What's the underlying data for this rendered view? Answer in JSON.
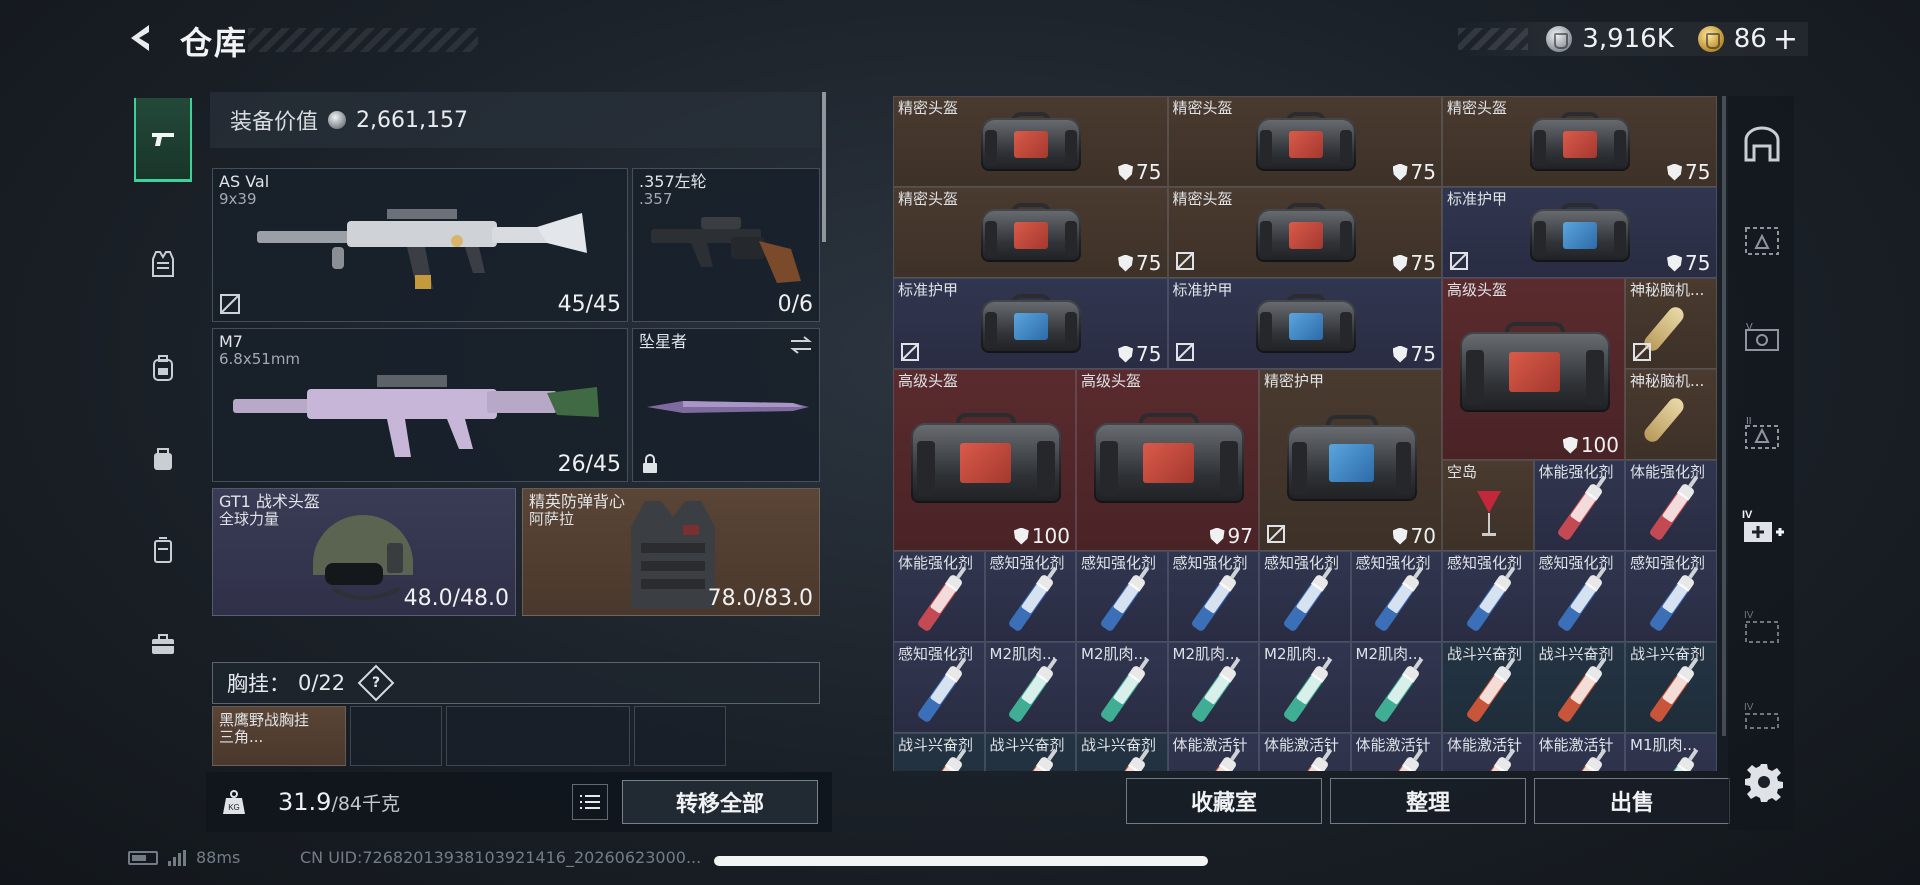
{
  "header": {
    "title": "仓库",
    "currency_silver": "3,916K",
    "currency_gold": "86",
    "currency_plus": "+"
  },
  "left": {
    "equip_value_label": "装备价值",
    "equip_value": "2,661,157",
    "weapon1": {
      "name": "AS Val",
      "sub": "9x39",
      "count": "45/45"
    },
    "weapon2": {
      "name": ".357左轮",
      "sub": ".357",
      "count": "0/6"
    },
    "weapon3": {
      "name": "M7",
      "sub": "6.8x51mm",
      "count": "26/45"
    },
    "melee": {
      "name": "坠星者"
    },
    "helmet": {
      "name": "GT1 战术头盔",
      "sub": "全球力量",
      "durability": "48.0/48.0"
    },
    "vest": {
      "name": "精英防弹背心",
      "sub": "阿萨拉",
      "durability": "78.0/83.0"
    },
    "chest_rig": {
      "label": "胸挂：",
      "count": "0/22",
      "help": "?"
    },
    "rig_item": {
      "name": "黑鹰野战胸挂",
      "sub": "三角..."
    },
    "weight_main": "31.9",
    "weight_sub": "/84千克",
    "transfer_all": "转移全部"
  },
  "grid": {
    "items": [
      {
        "label": "精密头盔",
        "value": "75",
        "color": "brown",
        "icon": "red-bag"
      },
      {
        "label": "精密头盔",
        "value": "75",
        "color": "brown",
        "icon": "red-bag"
      },
      {
        "label": "精密头盔",
        "value": "75",
        "color": "brown",
        "icon": "red-bag"
      },
      {
        "label": "精密头盔",
        "value": "75",
        "color": "brown",
        "icon": "red-bag"
      },
      {
        "label": "精密头盔",
        "value": "75",
        "color": "brown",
        "icon": "red-bag"
      },
      {
        "label": "标准护甲",
        "value": "75",
        "color": "purple",
        "icon": "blue-bag"
      },
      {
        "label": "标准护甲",
        "value": "75",
        "color": "purple",
        "icon": "blue-bag"
      },
      {
        "label": "标准护甲",
        "value": "75",
        "color": "purple",
        "icon": "blue-bag"
      },
      {
        "label": "高级头盔",
        "value": "100",
        "color": "red",
        "icon": "red-bag"
      },
      {
        "label": "神秘脑机...",
        "value": "",
        "color": "brown",
        "icon": "brain-chip"
      },
      {
        "label": "神秘脑机...",
        "value": "",
        "color": "brown",
        "icon": "brain-chip"
      },
      {
        "label": "高级头盔",
        "value": "100",
        "color": "red",
        "icon": "red-bag"
      },
      {
        "label": "高级头盔",
        "value": "97",
        "color": "red",
        "icon": "red-bag"
      },
      {
        "label": "精密护甲",
        "value": "70",
        "color": "brown",
        "icon": "blue-bag"
      },
      {
        "label": "空岛",
        "value": "",
        "color": "brown",
        "icon": "cocktail"
      },
      {
        "label": "体能强化剂",
        "value": "",
        "color": "purple",
        "icon": "syringe-red"
      },
      {
        "label": "体能强化剂",
        "value": "",
        "color": "purple",
        "icon": "syringe-red"
      }
    ],
    "row5": [
      "体能强化剂",
      "感知强化剂",
      "感知强化剂",
      "感知强化剂",
      "感知强化剂",
      "感知强化剂",
      "感知强化剂",
      "感知强化剂",
      "感知强化剂"
    ],
    "row6": [
      "感知强化剂",
      "M2肌肉...",
      "M2肌肉...",
      "M2肌肉...",
      "M2肌肉...",
      "M2肌肉...",
      "战斗兴奋剂",
      "战斗兴奋剂",
      "战斗兴奋剂"
    ],
    "row7": [
      "战斗兴奋剂",
      "战斗兴奋剂",
      "战斗兴奋剂",
      "体能激活针",
      "体能激活针",
      "体能激活针",
      "体能激活针",
      "体能激活针",
      "M1肌肉..."
    ]
  },
  "buttons": {
    "collection": "收藏室",
    "sort": "整理",
    "sell": "出售"
  },
  "status": {
    "ping": "88ms",
    "uid": "CN UID:7268201393810392141​6_20260623000..."
  },
  "colors": {
    "accent_green": "#3ed198",
    "cell_brown": "#4a3a2f",
    "cell_purple": "#313650",
    "cell_red": "#5a2b2e"
  }
}
